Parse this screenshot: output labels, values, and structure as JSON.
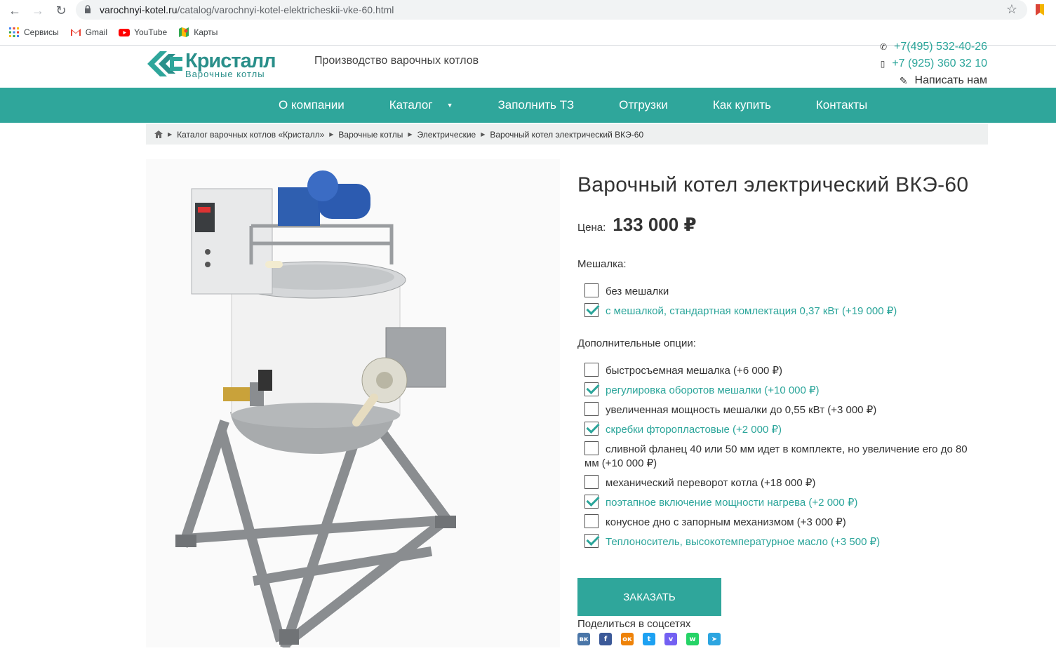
{
  "browser": {
    "url_host": "varochnyi-kotel.ru",
    "url_path": "/catalog/varochnyi-kotel-elektricheskii-vke-60.html",
    "bookmarks": [
      {
        "label": "Сервисы",
        "icon": "apps-grid-icon"
      },
      {
        "label": "Gmail",
        "icon": "gmail-icon"
      },
      {
        "label": "YouTube",
        "icon": "youtube-icon"
      },
      {
        "label": "Карты",
        "icon": "maps-icon"
      }
    ]
  },
  "header": {
    "logo_name": "Кристалл",
    "logo_sub": "Варочные котлы",
    "tagline": "Производство варочных котлов",
    "phone1": "+7(495) 532-40-26",
    "phone2": "+7 (925) 360 32 10",
    "write_us": "Написать нам"
  },
  "nav": {
    "items": [
      "О компании",
      "Каталог",
      "Заполнить ТЗ",
      "Отгрузки",
      "Как купить",
      "Контакты"
    ]
  },
  "breadcrumb": [
    "Каталог варочных котлов «Кристалл»",
    "Варочные котлы",
    "Электрические",
    "Варочный котел электрический ВКЭ-60"
  ],
  "product": {
    "title": "Варочный котел электрический ВКЭ-60",
    "price_label": "Цена:",
    "price": "133 000 ₽",
    "mixer_label": "Мешалка:",
    "mixer_options": [
      {
        "label": "без мешалки",
        "checked": false
      },
      {
        "label": "с мешалкой, стандартная комлектация 0,37 кВт (+19 000 ₽)",
        "checked": true
      }
    ],
    "extra_label": "Дополнительные опции:",
    "extra_options": [
      {
        "label": "быстросъемная мешалка (+6 000 ₽)",
        "checked": false
      },
      {
        "label": "регулировка оборотов мешалки (+10 000 ₽)",
        "checked": true
      },
      {
        "label": "увеличенная мощность мешалки до 0,55 кВт (+3 000 ₽)",
        "checked": false
      },
      {
        "label": "скребки фторопластовые (+2 000 ₽)",
        "checked": true
      },
      {
        "label": "сливной фланец 40 или 50 мм идет в комплекте, но увеличение его до 80 мм (+10 000 ₽)",
        "checked": false
      },
      {
        "label": "механический переворот котла (+18 000 ₽)",
        "checked": false
      },
      {
        "label": "поэтапное включение мощности нагрева (+2 000 ₽)",
        "checked": true
      },
      {
        "label": "конусное дно с запорным механизмом (+3 000 ₽)",
        "checked": false
      },
      {
        "label": "Теплоноситель, высокотемпературное масло (+3 500 ₽)",
        "checked": true
      }
    ],
    "order_button": "ЗАКАЗАТЬ",
    "share_label": "Поделиться в соцсетях",
    "social": [
      {
        "icon": "vk-icon",
        "glyph": "вк",
        "color": "#4a76a8"
      },
      {
        "icon": "facebook-icon",
        "glyph": "f",
        "color": "#3b5998"
      },
      {
        "icon": "odnoklassniki-icon",
        "glyph": "ок",
        "color": "#ee8208"
      },
      {
        "icon": "twitter-icon",
        "glyph": "t",
        "color": "#1da1f2"
      },
      {
        "icon": "viber-icon",
        "glyph": "v",
        "color": "#7360f2"
      },
      {
        "icon": "whatsapp-icon",
        "glyph": "w",
        "color": "#25d366"
      },
      {
        "icon": "telegram-icon",
        "glyph": "➤",
        "color": "#2ca5e0"
      }
    ]
  },
  "colors": {
    "accent": "#2fa69b",
    "link": "#2ba59a"
  }
}
